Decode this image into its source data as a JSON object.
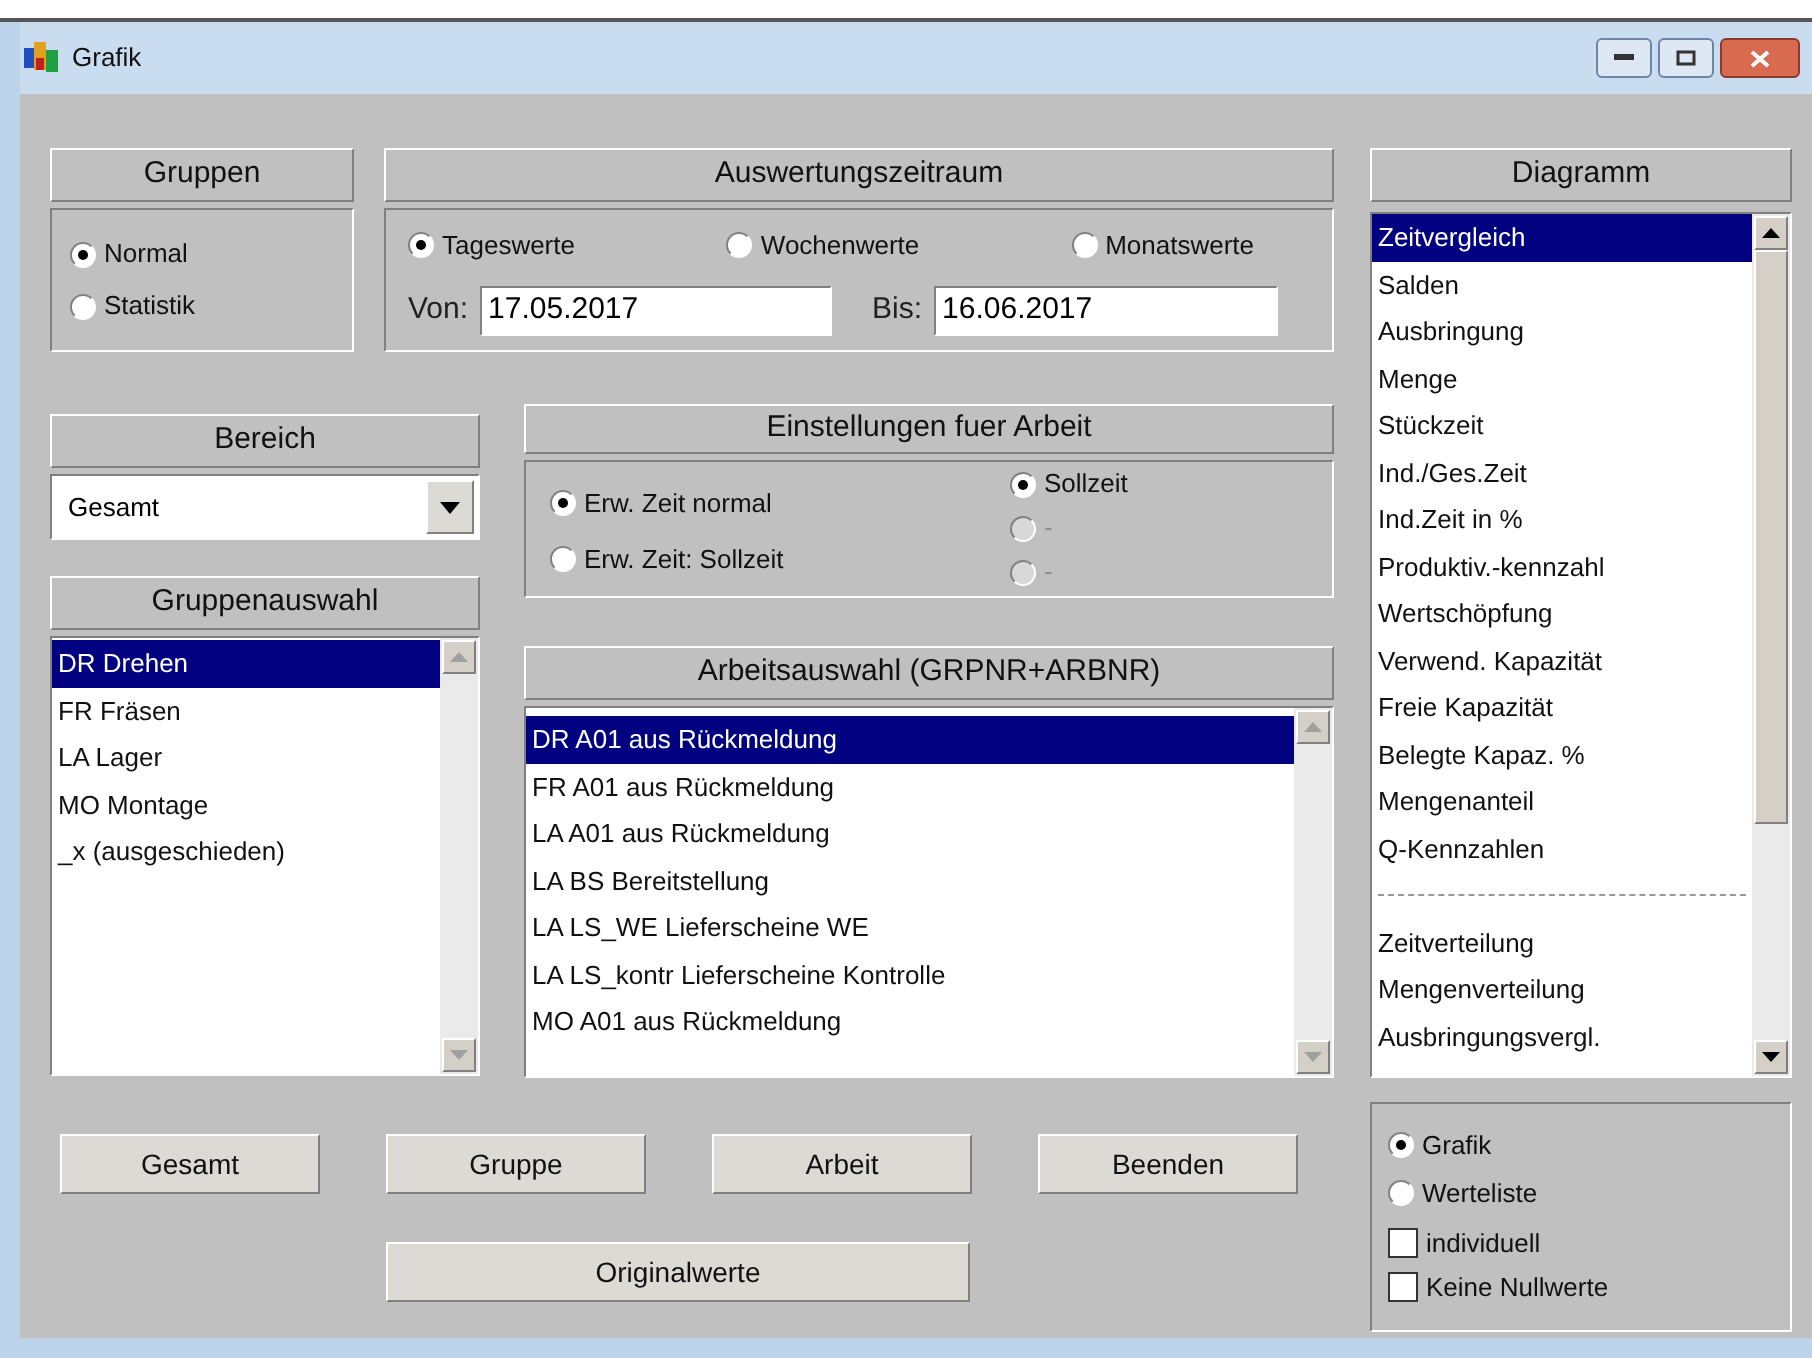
{
  "window": {
    "title": "Grafik"
  },
  "gruppen": {
    "title": "Gruppen",
    "options": [
      {
        "label": "Normal",
        "selected": true
      },
      {
        "label": "Statistik",
        "selected": false
      }
    ]
  },
  "zeitraum": {
    "title": "Auswertungszeitraum",
    "options": [
      {
        "label": "Tageswerte",
        "selected": true
      },
      {
        "label": "Wochenwerte",
        "selected": false
      },
      {
        "label": "Monatswerte",
        "selected": false
      }
    ],
    "von_label": "Von:",
    "von": "17.05.2017",
    "bis_label": "Bis:",
    "bis": "16.06.2017"
  },
  "bereich": {
    "title": "Bereich",
    "value": "Gesamt"
  },
  "gruppenauswahl": {
    "title": "Gruppenauswahl",
    "items": [
      {
        "label": "DR Drehen",
        "selected": true
      },
      {
        "label": "FR Fräsen",
        "selected": false
      },
      {
        "label": "LA Lager",
        "selected": false
      },
      {
        "label": "MO Montage",
        "selected": false
      },
      {
        "label": "_x (ausgeschieden)",
        "selected": false
      }
    ]
  },
  "einstellungen": {
    "title": "Einstellungen fuer Arbeit",
    "left_options": [
      {
        "label": "Erw. Zeit normal",
        "selected": true,
        "disabled": false
      },
      {
        "label": "Erw. Zeit: Sollzeit",
        "selected": false,
        "disabled": false
      }
    ],
    "right_options": [
      {
        "label": "Sollzeit",
        "selected": true,
        "disabled": false
      },
      {
        "label": "-",
        "selected": false,
        "disabled": true
      },
      {
        "label": "-",
        "selected": false,
        "disabled": true
      }
    ]
  },
  "arbeitsauswahl": {
    "title": "Arbeitsauswahl (GRPNR+ARBNR)",
    "items": [
      {
        "label": "DR A01 aus Rückmeldung",
        "selected": true
      },
      {
        "label": "FR A01 aus Rückmeldung",
        "selected": false
      },
      {
        "label": "LA A01 aus Rückmeldung",
        "selected": false
      },
      {
        "label": "LA BS Bereitstellung",
        "selected": false
      },
      {
        "label": "LA LS_WE Lieferscheine WE",
        "selected": false
      },
      {
        "label": "LA LS_kontr Lieferscheine Kontrolle",
        "selected": false
      },
      {
        "label": "MO A01 aus Rückmeldung",
        "selected": false
      }
    ]
  },
  "diagramm": {
    "title": "Diagramm",
    "items": [
      {
        "kind": "item",
        "label": "Zeitvergleich",
        "selected": true
      },
      {
        "kind": "item",
        "label": "Salden",
        "selected": false
      },
      {
        "kind": "item",
        "label": "Ausbringung",
        "selected": false
      },
      {
        "kind": "item",
        "label": "Menge",
        "selected": false
      },
      {
        "kind": "item",
        "label": "Stückzeit",
        "selected": false
      },
      {
        "kind": "item",
        "label": "Ind./Ges.Zeit",
        "selected": false
      },
      {
        "kind": "item",
        "label": "Ind.Zeit in %",
        "selected": false
      },
      {
        "kind": "item",
        "label": "Produktiv.-kennzahl",
        "selected": false
      },
      {
        "kind": "item",
        "label": "Wertschöpfung",
        "selected": false
      },
      {
        "kind": "item",
        "label": "Verwend. Kapazität",
        "selected": false
      },
      {
        "kind": "item",
        "label": "Freie Kapazität",
        "selected": false
      },
      {
        "kind": "item",
        "label": "Belegte Kapaz. %",
        "selected": false
      },
      {
        "kind": "item",
        "label": "Mengenanteil",
        "selected": false
      },
      {
        "kind": "item",
        "label": "Q-Kennzahlen",
        "selected": false
      },
      {
        "kind": "separator"
      },
      {
        "kind": "item",
        "label": "Zeitverteilung",
        "selected": false
      },
      {
        "kind": "item",
        "label": "Mengenverteilung",
        "selected": false
      },
      {
        "kind": "item",
        "label": "Ausbringungsvergl.",
        "selected": false
      }
    ]
  },
  "buttons": [
    "Gesamt",
    "Gruppe",
    "Arbeit",
    "Beenden"
  ],
  "original_button": "Originalwerte",
  "ausgabe": {
    "options": [
      {
        "label": "Grafik",
        "selected": true
      },
      {
        "label": "Werteliste",
        "selected": false
      }
    ],
    "checks": [
      {
        "label": "individuell",
        "checked": false
      },
      {
        "label": "Keine Nullwerte",
        "checked": false
      }
    ]
  }
}
